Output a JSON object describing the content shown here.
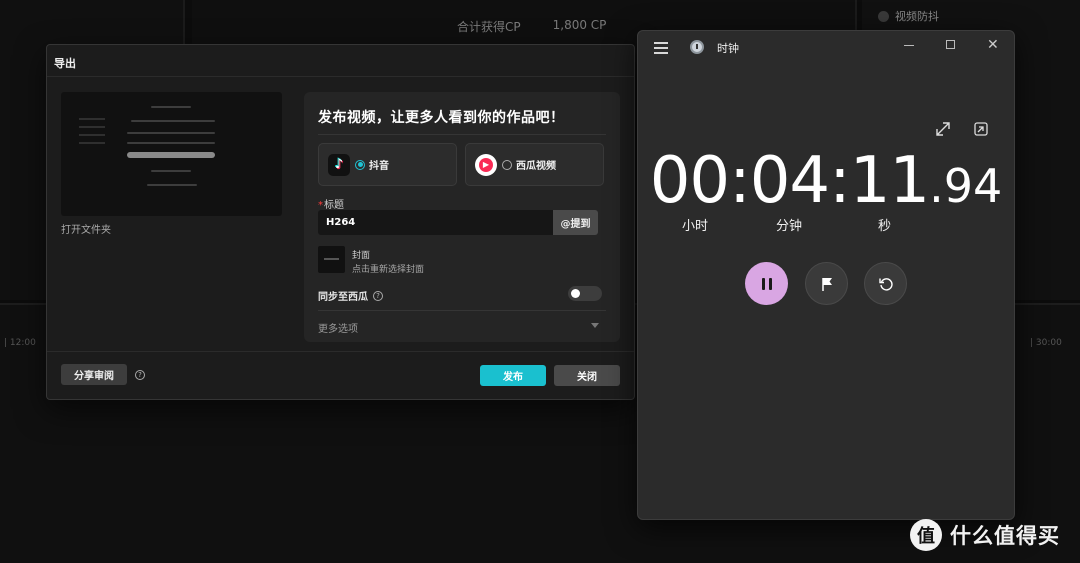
{
  "background": {
    "cp_label": "合计获得CP",
    "cp_value": "1,800 CP",
    "anti_shake_label": "视频防抖",
    "tick_left": "| 12:00",
    "tick_right": "| 30:00"
  },
  "export_dialog": {
    "title": "导出",
    "open_folder": "打开文件夹",
    "headline": "发布视频，让更多人看到你的作品吧！",
    "platforms": [
      {
        "label": "抖音",
        "selected": true
      },
      {
        "label": "西瓜视频",
        "selected": false
      }
    ],
    "title_field_label": "标题",
    "title_required_mark": "*",
    "title_value": "H264",
    "mention_button": "@提到",
    "cover_title": "封面",
    "cover_hint": "点击重新选择封面",
    "sync_label": "同步至西瓜",
    "sync_enabled": false,
    "more_options": "更多选项",
    "share_review_button": "分享审阅",
    "publish_button": "发布",
    "close_button": "关闭",
    "accent_color": "#1ac0cf"
  },
  "clock_app": {
    "app_title": "时钟",
    "time_hours": "00",
    "time_minutes": "04",
    "time_seconds": "11",
    "time_centis": ".94",
    "separator": ":",
    "unit_hours": "小时",
    "unit_minutes": "分钟",
    "unit_seconds": "秒",
    "pause_color": "#d9a6e3"
  },
  "watermark": {
    "logo_char": "值",
    "text": "什么值得买"
  }
}
